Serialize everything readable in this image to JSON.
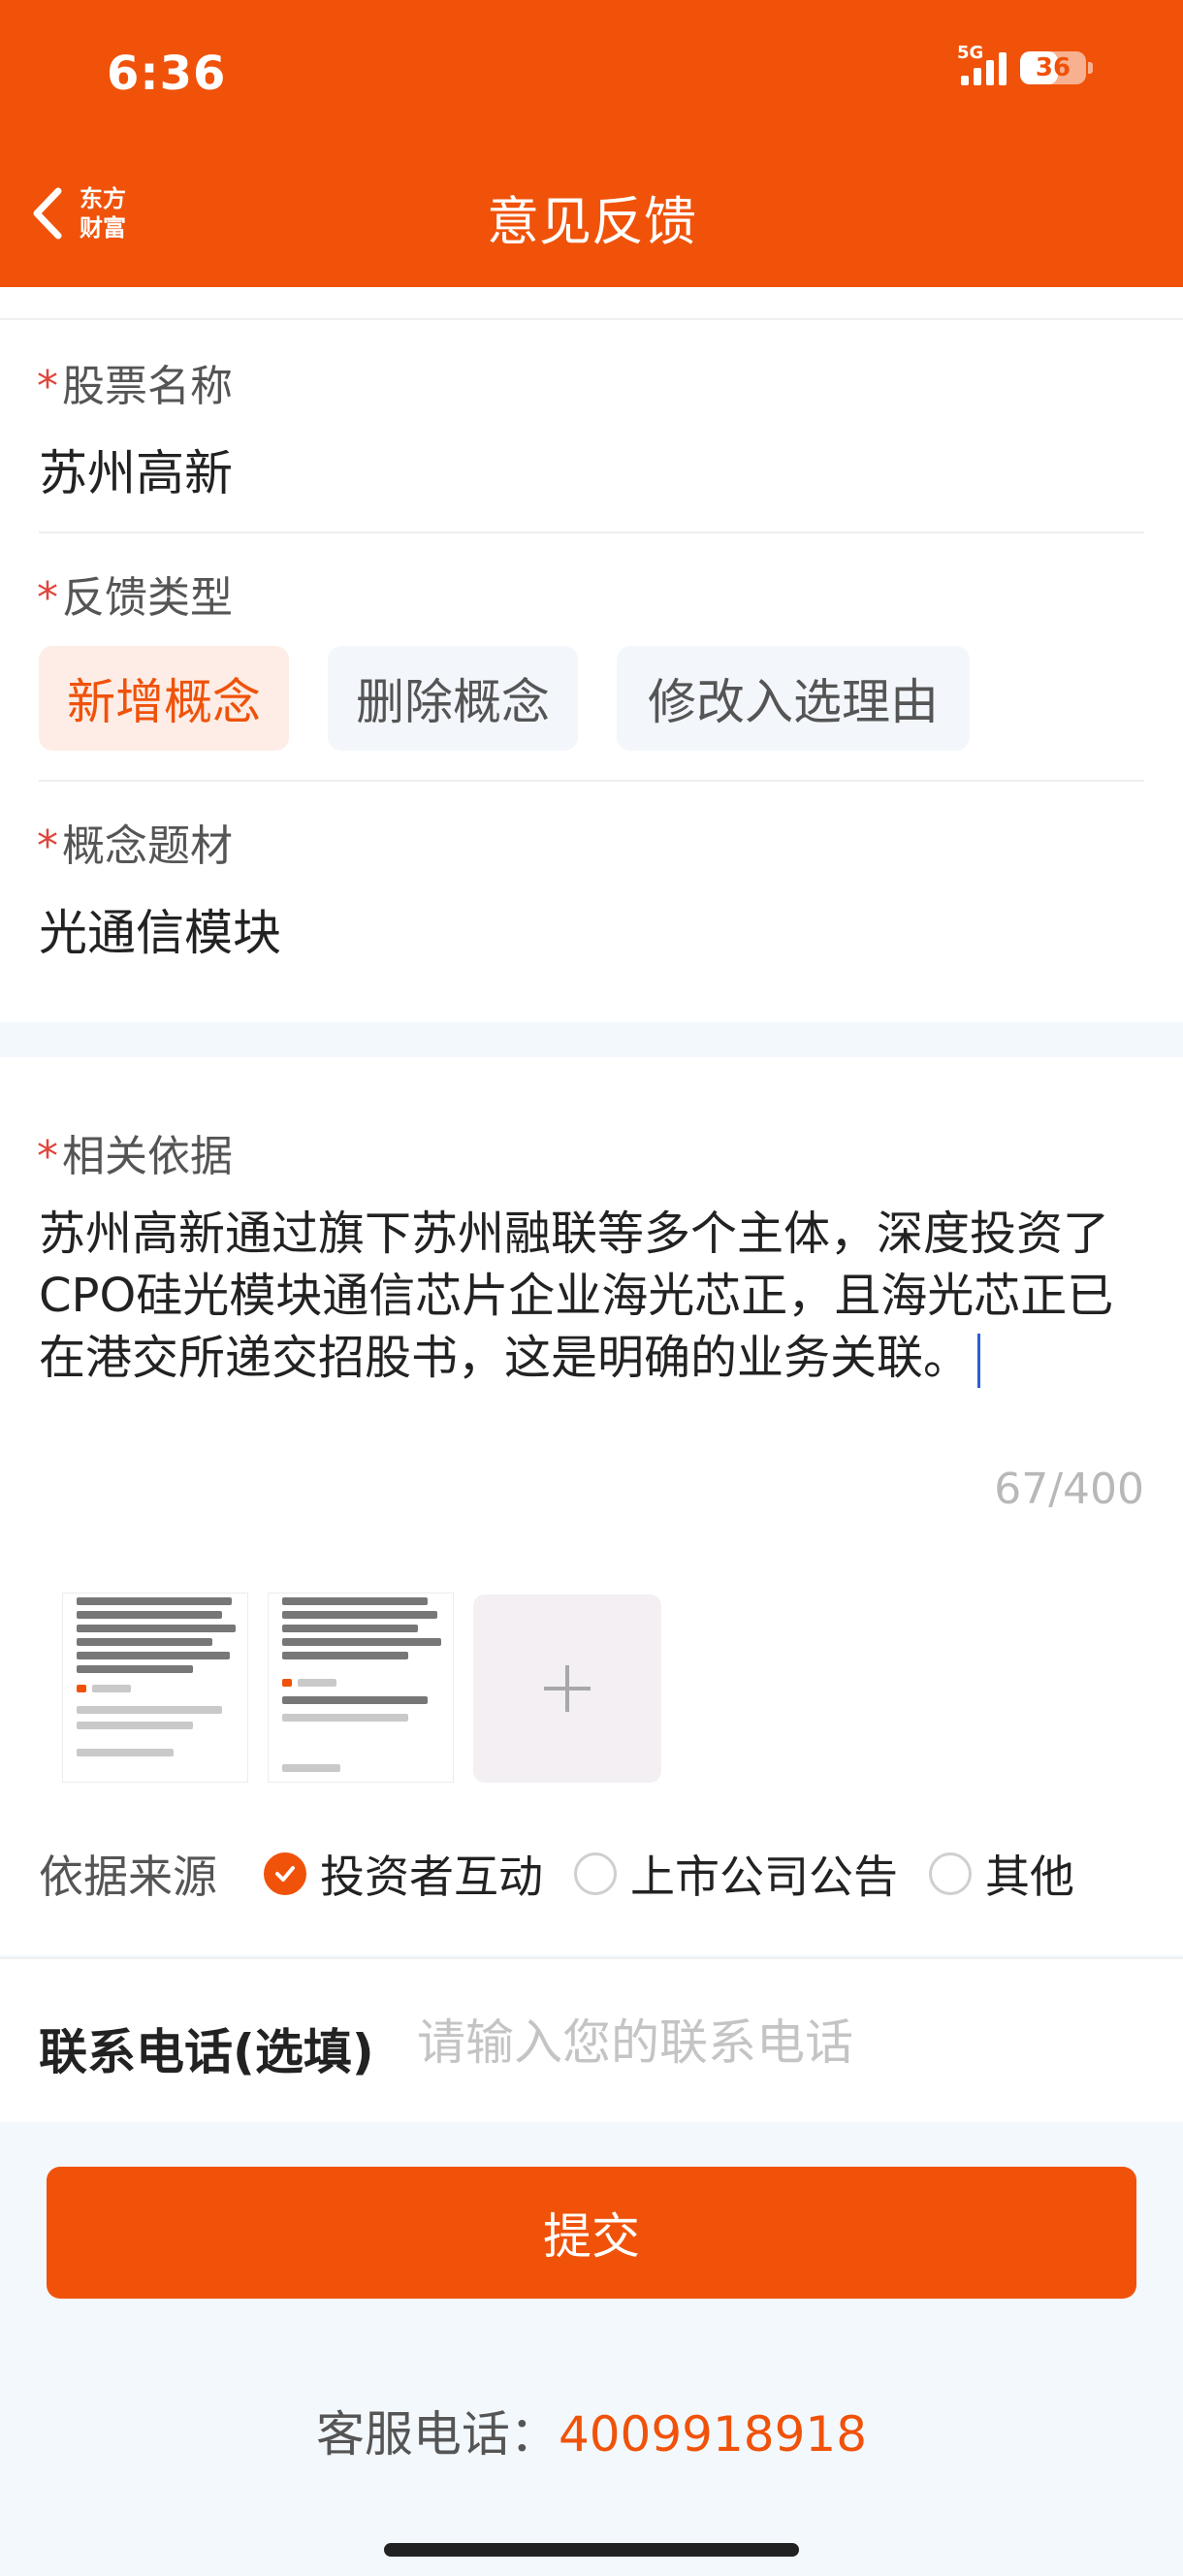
{
  "status_bar": {
    "time": "6:36",
    "network": "5G",
    "battery": "36"
  },
  "header": {
    "logo_line1": "东方",
    "logo_line2": "财富",
    "title": "意见反馈"
  },
  "form": {
    "stock": {
      "label": "股票名称",
      "value": "苏州高新"
    },
    "feedback_type": {
      "label": "反馈类型",
      "options": [
        "新增概念",
        "删除概念",
        "修改入选理由"
      ],
      "selected": "新增概念"
    },
    "concept": {
      "label": "概念题材",
      "value": "光通信模块"
    },
    "basis": {
      "label": "相关依据",
      "text": "苏州高新通过旗下苏州融联等多个主体，深度投资了CPO硅光模块通信芯片企业海光芯正，且海光芯正已在港交所递交招股书，这是明确的业务关联。",
      "counter": "67/400"
    },
    "source": {
      "label": "依据来源",
      "options": [
        "投资者互动",
        "上市公司公告",
        "其他"
      ],
      "selected": "投资者互动"
    },
    "phone": {
      "label": "联系电话(选填)",
      "placeholder": "请输入您的联系电话",
      "value": ""
    }
  },
  "submit_label": "提交",
  "service": {
    "label": "客服电话：",
    "number": "4009918918"
  },
  "colors": {
    "accent": "#F0520A",
    "required_star": "#E0453A",
    "page_bg": "#F3F8FD"
  }
}
